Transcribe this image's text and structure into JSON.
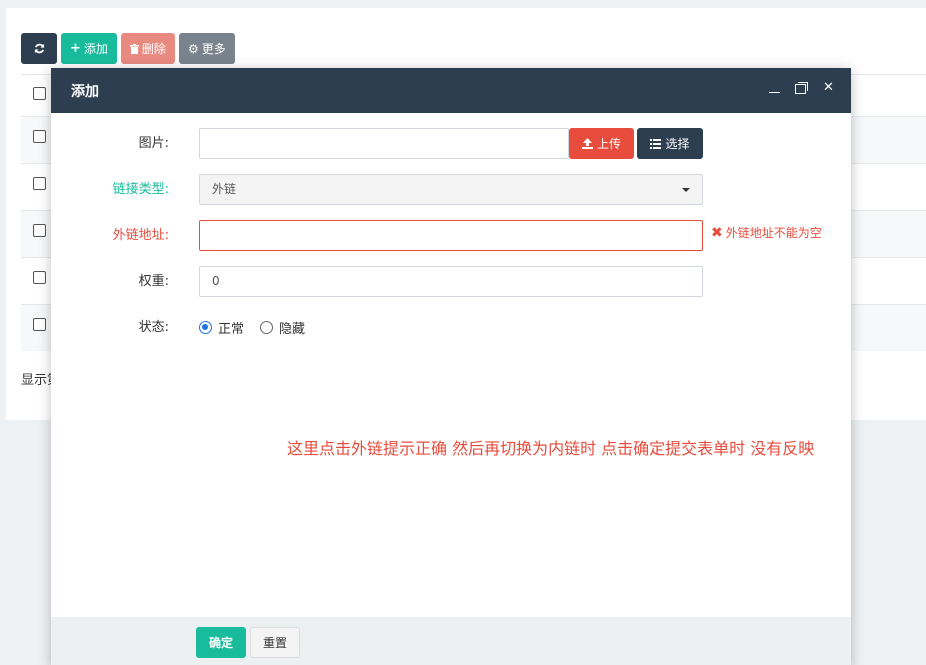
{
  "toolbar": {
    "refresh_icon": "refresh-icon",
    "add_label": "添加",
    "delete_label": "删除",
    "more_label": "更多",
    "colors": {
      "dark": "#2c3e50",
      "success": "#18bc9c",
      "danger": "#e88a80",
      "gray": "#78838d"
    }
  },
  "background_footer": "显示第",
  "modal": {
    "title": "添加",
    "fields": {
      "image": {
        "label": "图片:",
        "value": "",
        "upload_label": "上传",
        "choose_label": "选择"
      },
      "link_type": {
        "label": "链接类型:",
        "selected": "外链"
      },
      "link_url": {
        "label": "外链地址:",
        "value": "",
        "error": "外链地址不能为空"
      },
      "weight": {
        "label": "权重:",
        "value": "0"
      },
      "status": {
        "label": "状态:",
        "options": [
          "正常",
          "隐藏"
        ],
        "selected": "正常"
      }
    },
    "note": "这里点击外链提示正确 然后再切换为内链时  点击确定提交表单时 没有反映",
    "footer": {
      "ok_label": "确定",
      "reset_label": "重置"
    }
  }
}
